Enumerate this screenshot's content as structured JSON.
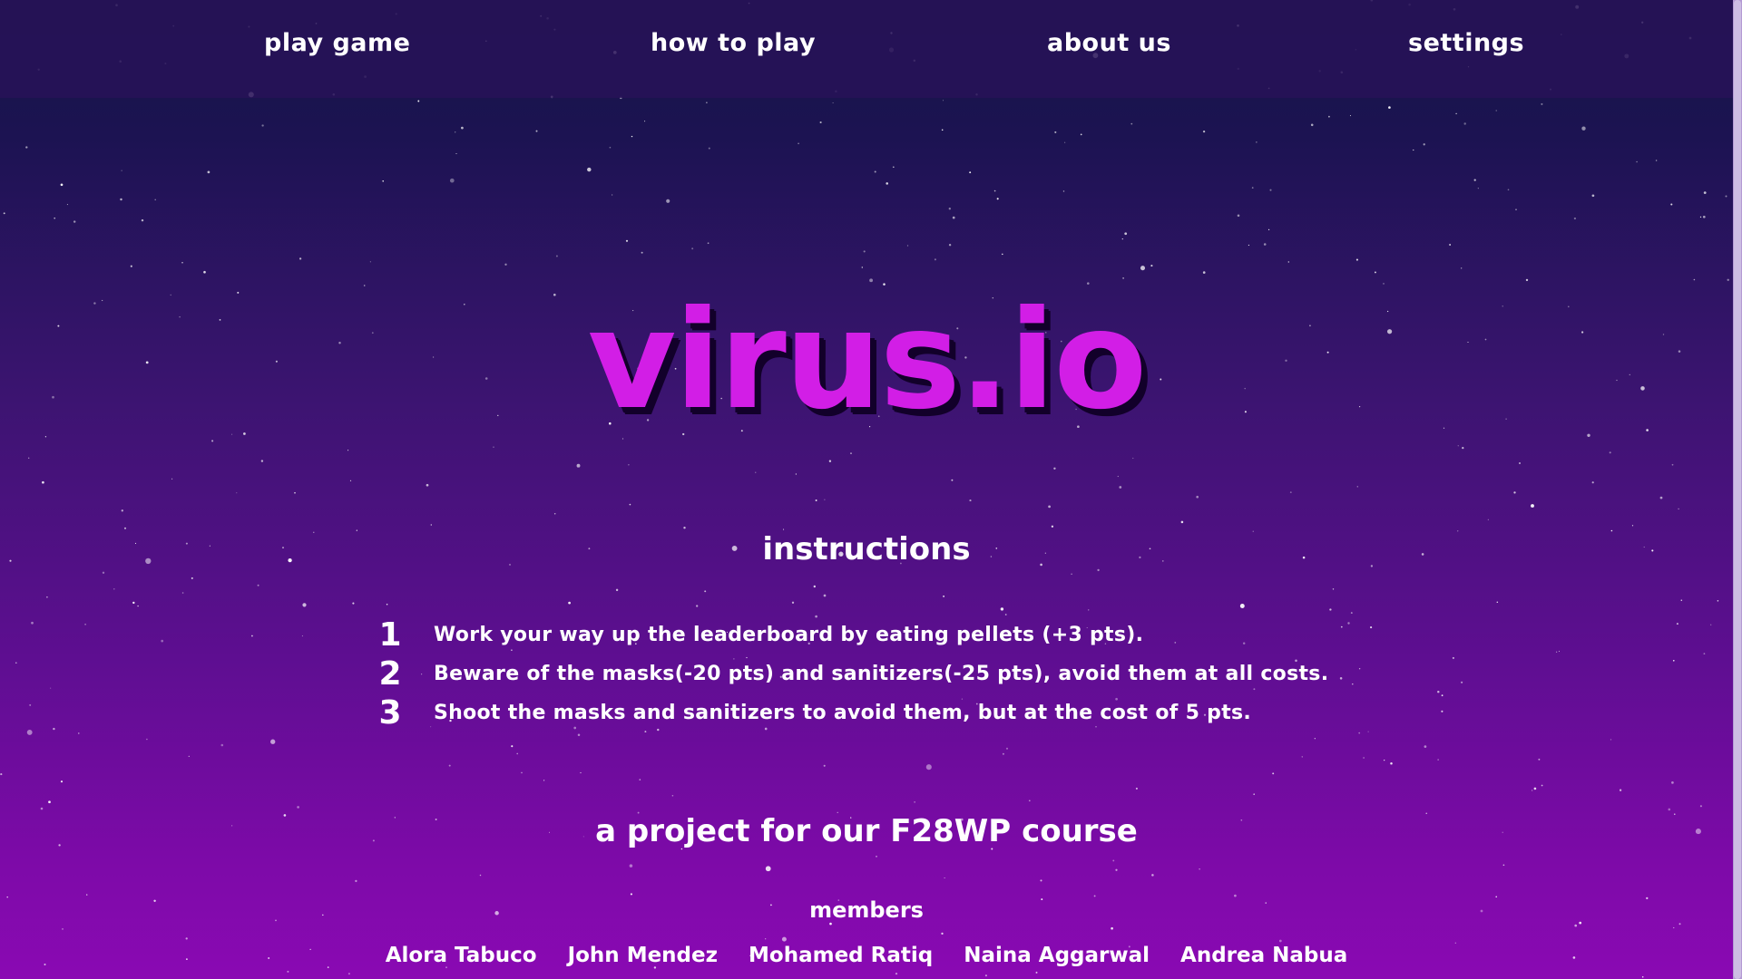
{
  "nav": {
    "play_game": "play game",
    "how_to_play": "how to play",
    "about_us": "about us",
    "settings": "settings"
  },
  "title": "virus.io",
  "instructions": {
    "heading": "instructions",
    "items": [
      {
        "number": "1",
        "text": "Work your way up the leaderboard by eating pellets (+3 pts)."
      },
      {
        "number": "2",
        "text": "Beware of the masks(-20 pts) and sanitizers(-25 pts), avoid them at all costs."
      },
      {
        "number": "3",
        "text": "Shoot the masks and sanitizers to avoid them, but at the cost of 5 pts."
      }
    ]
  },
  "project": {
    "heading": "a project for our F28WP course",
    "members_label": "members",
    "members": [
      "Alora Tabuco",
      "John Mendez",
      "Mohamed Ratiq",
      "Naina Aggarwal",
      "Andrea Nabua"
    ]
  },
  "colors": {
    "title": "#d21ee6",
    "title_shadow": "#12002a",
    "nav_bg": "#281258",
    "bg_top": "#141545",
    "bg_bottom": "#8a09b3"
  }
}
